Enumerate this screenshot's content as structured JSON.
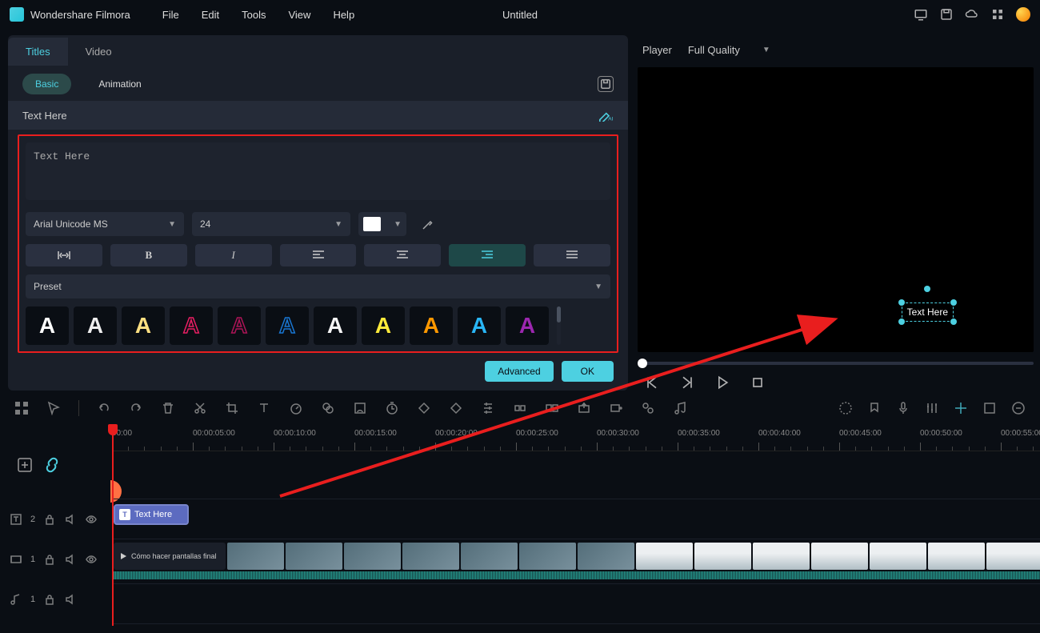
{
  "app": {
    "name": "Wondershare Filmora",
    "doc_title": "Untitled"
  },
  "menu": {
    "file": "File",
    "edit": "Edit",
    "tools": "Tools",
    "view": "View",
    "help": "Help"
  },
  "panel": {
    "tabs": {
      "titles": "Titles",
      "video": "Video"
    },
    "subtabs": {
      "basic": "Basic",
      "animation": "Animation"
    },
    "section_label": "Text Here",
    "text_value": "Text Here",
    "font": "Arial Unicode MS",
    "size": "24",
    "preset_label": "Preset",
    "buttons": {
      "advanced": "Advanced",
      "ok": "OK"
    }
  },
  "preview": {
    "player_label": "Player",
    "quality": "Full Quality",
    "overlay_text": "Text Here"
  },
  "timeline": {
    "marks": [
      "00:00",
      "00:00:05:00",
      "00:00:10:00",
      "00:00:15:00",
      "00:00:20:00",
      "00:00:25:00",
      "00:00:30:00",
      "00:00:35:00",
      "00:00:40:00",
      "00:00:45:00",
      "00:00:50:00",
      "00:00:55:00"
    ],
    "text_clip": "Text Here",
    "video_clip": "Cómo hacer pantallas final",
    "tracks": {
      "text": "2",
      "video": "1",
      "audio": "1"
    }
  },
  "preset_colors": [
    {
      "fill": "#fff",
      "stroke": "none"
    },
    {
      "fill": "#eee",
      "stroke": "none"
    },
    {
      "fill": "#ffe082",
      "stroke": "none"
    },
    {
      "fill": "transparent",
      "stroke": "#e91e63"
    },
    {
      "fill": "transparent",
      "stroke": "#ad1457"
    },
    {
      "fill": "transparent",
      "stroke": "#1976d2"
    },
    {
      "fill": "#f5f5f5",
      "stroke": "none"
    },
    {
      "fill": "#ffeb3b",
      "stroke": "none"
    },
    {
      "fill": "#ff9800",
      "stroke": "none"
    },
    {
      "fill": "#29b6f6",
      "stroke": "none"
    },
    {
      "fill": "#9c27b0",
      "stroke": "none"
    }
  ]
}
